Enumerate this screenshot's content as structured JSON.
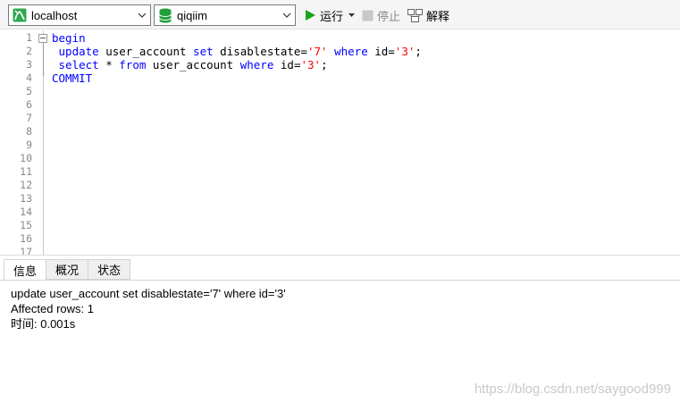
{
  "toolbar": {
    "connection": {
      "value": "localhost",
      "icon": "connection-icon"
    },
    "database": {
      "value": "qiqiim",
      "icon": "database-icon"
    },
    "run_label": "运行",
    "stop_label": "停止",
    "explain_label": "解释"
  },
  "editor": {
    "line_numbers": [
      "1",
      "2",
      "3",
      "4",
      "5",
      "6",
      "7",
      "8",
      "9",
      "10",
      "11",
      "12",
      "13",
      "14",
      "15",
      "16",
      "17"
    ]
  },
  "results": {
    "tabs": [
      {
        "label": "信息",
        "active": true
      },
      {
        "label": "概况",
        "active": false
      },
      {
        "label": "状态",
        "active": false
      }
    ],
    "messages": [
      "update user_account set disablestate='7' where id='3'",
      "Affected rows: 1",
      "时间: 0.001s"
    ],
    "watermark": "https://blog.csdn.net/saygood999"
  },
  "colors": {
    "keyword": "#0000ff",
    "string": "#ff0000",
    "run_green": "#1aa31a",
    "db_green": "#21a03a"
  }
}
